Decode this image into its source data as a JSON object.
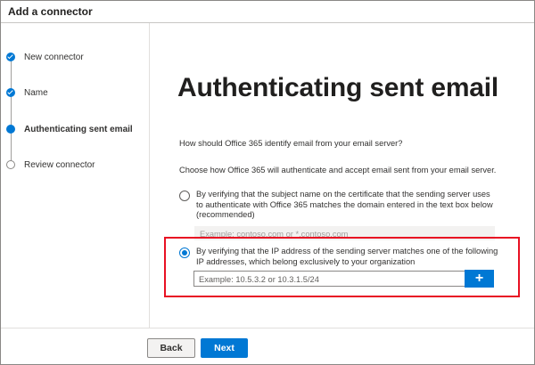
{
  "window": {
    "title": "Add a connector"
  },
  "steps": [
    {
      "label": "New connector",
      "state": "done"
    },
    {
      "label": "Name",
      "state": "done"
    },
    {
      "label": "Authenticating sent email",
      "state": "current"
    },
    {
      "label": "Review connector",
      "state": "todo"
    }
  ],
  "main": {
    "heading": "Authenticating sent email",
    "question": "How should Office 365 identify email from your email server?",
    "instruction": "Choose how Office 365 will authenticate and accept email sent from your email server.",
    "options": [
      {
        "text": "By verifying that the subject name on the certificate that the sending server uses to authenticate with Office 365 matches the domain entered in the text box below (recommended)",
        "selected": false,
        "input_placeholder": "Example: contoso.com or *.contoso.com"
      },
      {
        "text": "By verifying that the IP address of the sending server matches one of the following IP addresses, which belong exclusively to your organization",
        "selected": true,
        "input_placeholder": "Example: 10.5.3.2 or 10.3.1.5/24",
        "add_button": "+"
      }
    ]
  },
  "footer": {
    "back_label": "Back",
    "next_label": "Next"
  },
  "colors": {
    "accent": "#0078d4",
    "highlight": "#e81123"
  }
}
